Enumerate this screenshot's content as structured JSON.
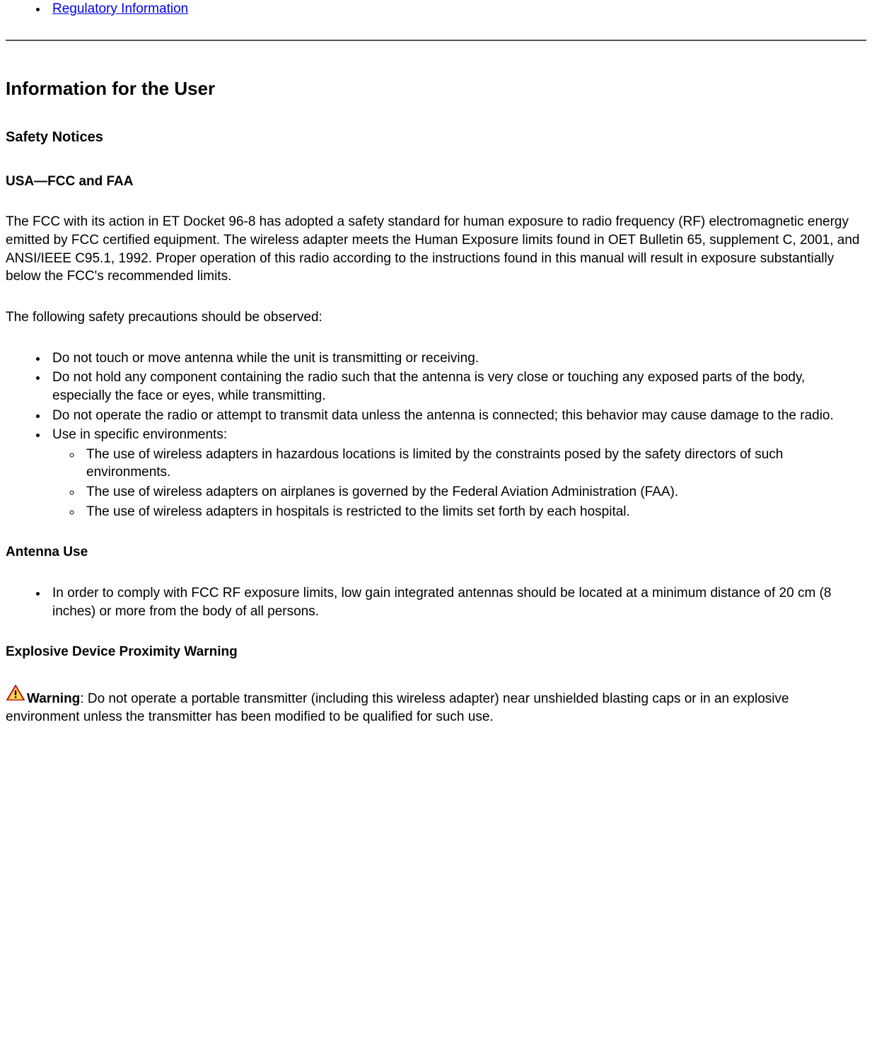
{
  "topLink": "Regulatory Information",
  "heading1": "Information for the User",
  "heading2": "Safety Notices",
  "heading3": "USA—FCC and FAA",
  "para1": "The FCC with its action in ET Docket 96-8 has adopted a safety standard for human exposure to radio frequency (RF) electromagnetic energy emitted by FCC certified equipment. The wireless adapter meets the Human Exposure limits found in OET Bulletin 65, supplement C, 2001, and ANSI/IEEE C95.1, 1992. Proper operation of this radio according to the instructions found in this manual will result in exposure substantially below the FCC's recommended limits.",
  "para2": "The following safety precautions should be observed:",
  "precautions": {
    "item1": "Do not touch or move antenna while the unit is transmitting or receiving.",
    "item2": "Do not hold any component containing the radio such that the antenna is very close or touching any exposed parts of the body, especially the face or eyes, while transmitting.",
    "item3": "Do not operate the radio or attempt to transmit data unless the antenna is connected; this behavior may cause damage to the radio.",
    "item4": "Use in specific environments:",
    "sub": {
      "s1": "The use of wireless adapters in hazardous locations is limited by the constraints posed by the safety directors of such environments.",
      "s2": "The use of wireless adapters on airplanes is governed by the Federal Aviation Administration (FAA).",
      "s3": "The use of wireless adapters in hospitals is restricted to the limits set forth by each hospital."
    }
  },
  "heading4": "Antenna Use",
  "antenna": {
    "item1": "In order to comply with FCC RF exposure limits, low gain integrated antennas should be located at a minimum distance of 20 cm (8 inches) or more from the body of all persons."
  },
  "heading5": "Explosive Device Proximity Warning",
  "warningLabel": "Warning",
  "warningText": ": Do not operate a portable transmitter (including this wireless adapter) near unshielded blasting caps or in an explosive environment unless the transmitter has been modified to be qualified for such use."
}
